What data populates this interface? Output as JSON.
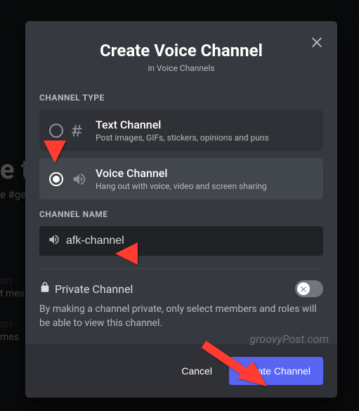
{
  "modal": {
    "title": "Create Voice Channel",
    "subtitle": "in Voice Channels",
    "close_icon": "close"
  },
  "channel_type": {
    "label": "CHANNEL TYPE",
    "options": [
      {
        "title": "Text Channel",
        "desc": "Post images, GIFs, stickers, opinions and puns",
        "selected": false
      },
      {
        "title": "Voice Channel",
        "desc": "Hang out with voice, video and screen sharing",
        "selected": true
      }
    ]
  },
  "channel_name": {
    "label": "CHANNEL NAME",
    "value": "afk-channel"
  },
  "private": {
    "label": "Private Channel",
    "enabled": false,
    "desc": "By making a channel private, only select members and roles will be able to view this channel."
  },
  "footer": {
    "cancel": "Cancel",
    "submit": "Create Channel"
  },
  "watermark": "groovyPost.com",
  "background": {
    "frag1": "e to",
    "frag2": "e #ge",
    "frag3": "021",
    "frag4": "t mes",
    "frag5": "021",
    "frag6": "mes"
  }
}
